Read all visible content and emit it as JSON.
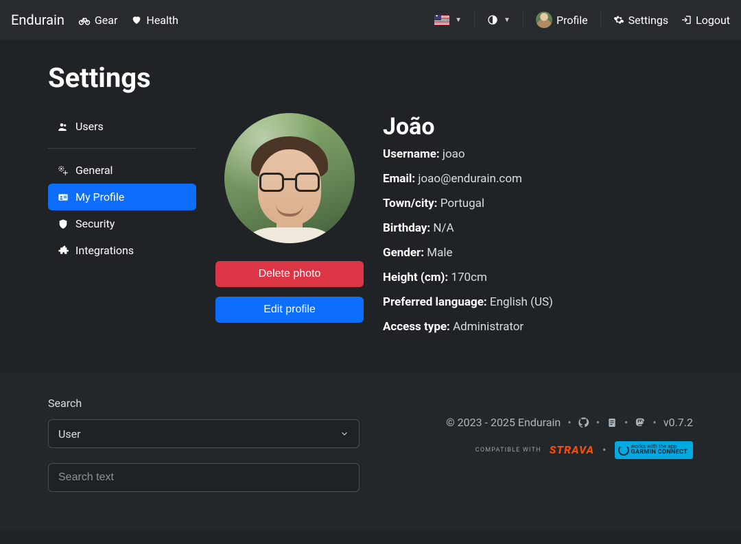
{
  "navbar": {
    "brand": "Endurain",
    "gear": "Gear",
    "health": "Health",
    "profile": "Profile",
    "settings": "Settings",
    "logout": "Logout"
  },
  "page": {
    "title": "Settings"
  },
  "sidebar": {
    "users": "Users",
    "general": "General",
    "my_profile": "My Profile",
    "security": "Security",
    "integrations": "Integrations"
  },
  "profile": {
    "name": "João",
    "delete_photo": "Delete photo",
    "edit_profile": "Edit profile",
    "fields": {
      "username": {
        "label": "Username:",
        "value": "joao"
      },
      "email": {
        "label": "Email:",
        "value": "joao@endurain.com"
      },
      "town": {
        "label": "Town/city:",
        "value": "Portugal"
      },
      "birthday": {
        "label": "Birthday:",
        "value": "N/A"
      },
      "gender": {
        "label": "Gender:",
        "value": "Male"
      },
      "height": {
        "label": "Height (cm):",
        "value": "170cm"
      },
      "language": {
        "label": "Preferred language:",
        "value": "English (US)"
      },
      "access": {
        "label": "Access type:",
        "value": "Administrator"
      }
    }
  },
  "footer": {
    "search_label": "Search",
    "select_value": "User",
    "search_placeholder": "Search text",
    "copyright": "© 2023 - 2025 Endurain",
    "version": "v0.7.2",
    "compatible": "COMPATIBLE WITH",
    "strava": "STRAVA",
    "garmin_top": "works with the app",
    "garmin_bottom": "GARMIN CONNECT"
  }
}
